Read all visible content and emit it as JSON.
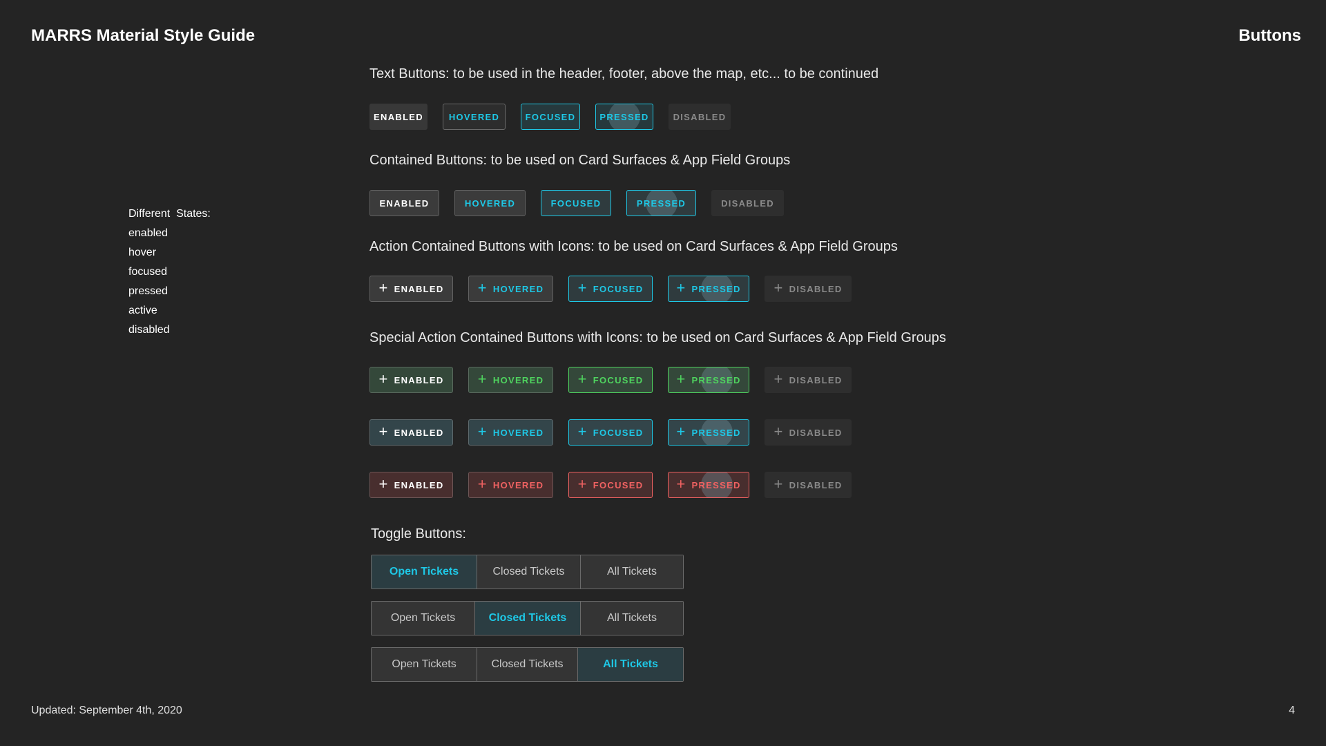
{
  "header": {
    "brand": "MARRS",
    "title_rest": " Material Style Guide",
    "page_name": "Buttons"
  },
  "footer": {
    "updated": "Updated: September 4th, 2020",
    "page_number": "4"
  },
  "states_list": {
    "heading": "Different  States:",
    "items": [
      "enabled",
      "hover",
      "focused",
      "pressed",
      "active",
      "disabled"
    ]
  },
  "sections": {
    "text_buttons": "Text Buttons: to be used in the header, footer, above the map, etc... to be continued",
    "contained_buttons": "Contained Buttons: to be used on Card Surfaces & App Field Groups",
    "action_contained": "Action Contained Buttons with Icons: to be used on Card Surfaces & App Field Groups",
    "special_action": "Special Action Contained Buttons with Icons: to be used on Card Surfaces & App Field Groups",
    "toggle_buttons": "Toggle Buttons:"
  },
  "button_labels": {
    "enabled": "ENABLED",
    "hovered": "HOVERED",
    "focused": "FOCUSED",
    "pressed": "PRESSED",
    "disabled": "DISABLED",
    "plus": "+"
  },
  "toggles": {
    "open": "Open Tickets",
    "closed": "Closed Tickets",
    "all": "All Tickets"
  },
  "colors": {
    "accent_cyan": "#1ec8e6",
    "accent_green": "#4fd45f",
    "accent_red": "#f06262",
    "background": "#242424"
  }
}
